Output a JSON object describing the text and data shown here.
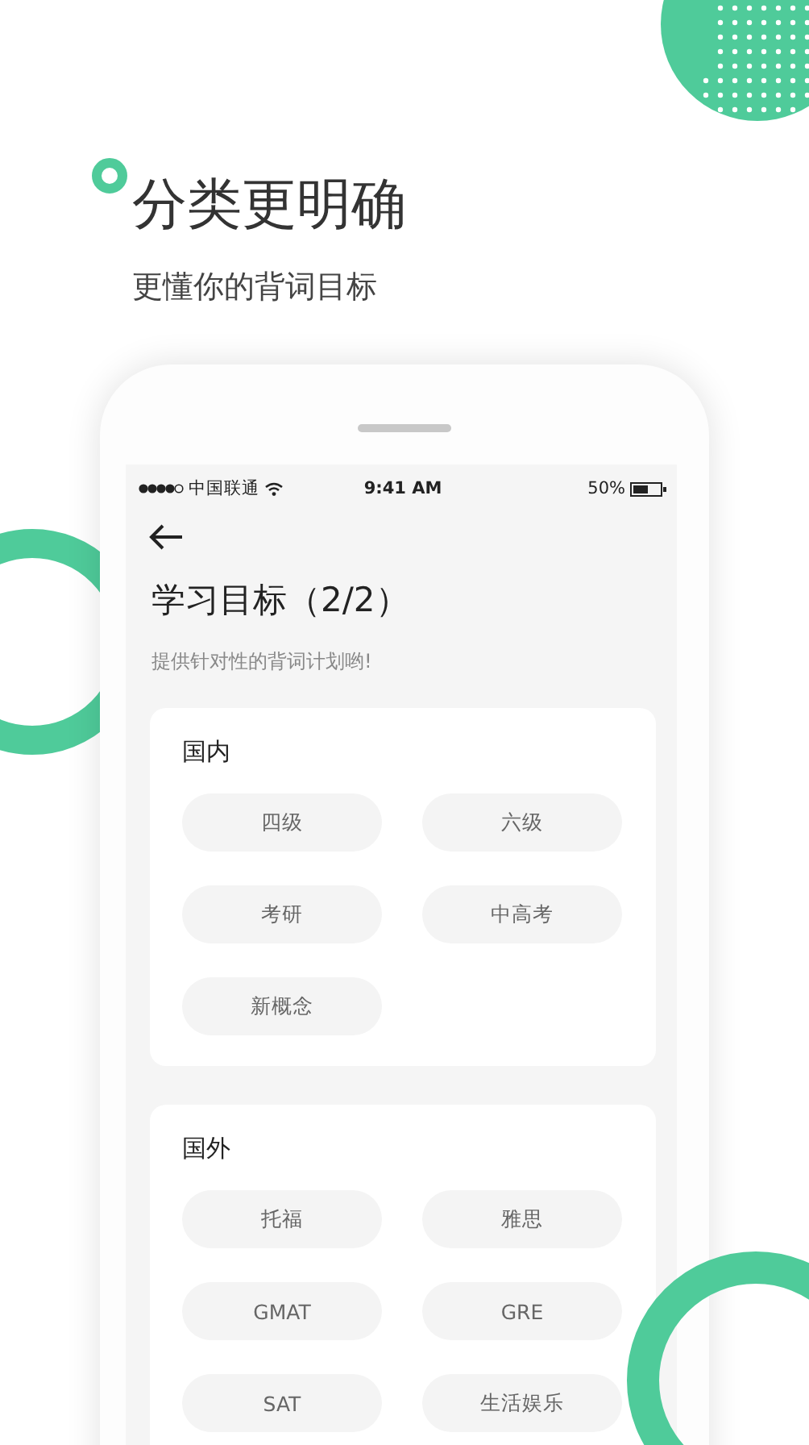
{
  "headline": {
    "title": "分类更明确",
    "subtitle": "更懂你的背词目标"
  },
  "status_bar": {
    "carrier": "中国联通",
    "time": "9:41 AM",
    "battery": "50%"
  },
  "page": {
    "title": "学习目标（2/2）",
    "subtitle": "提供针对性的背词计划哟!"
  },
  "sections": [
    {
      "title": "国内",
      "options": [
        "四级",
        "六级",
        "考研",
        "中高考",
        "新概念"
      ]
    },
    {
      "title": "国外",
      "options": [
        "托福",
        "雅思",
        "GMAT",
        "GRE",
        "SAT",
        "生活娱乐"
      ]
    }
  ]
}
